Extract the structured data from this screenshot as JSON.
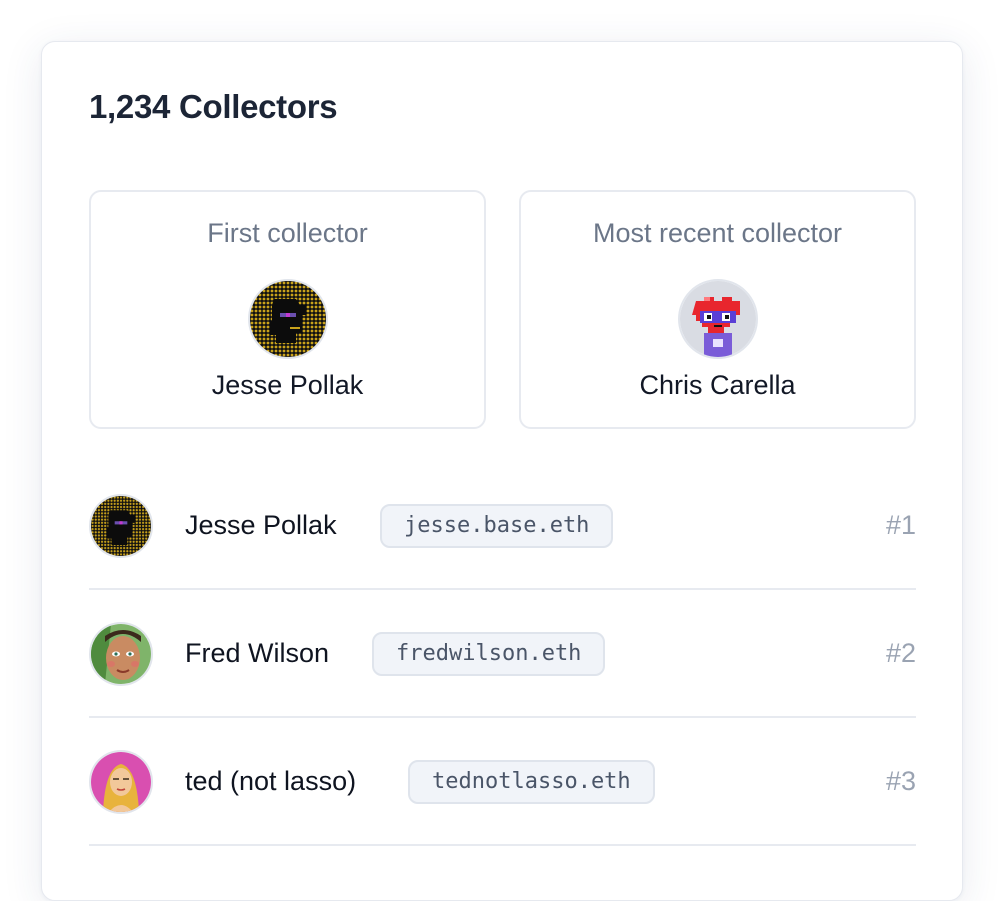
{
  "header": {
    "title": "1,234 Collectors"
  },
  "highlights": {
    "first": {
      "label": "First collector",
      "name": "Jesse Pollak",
      "avatar_icon": "pixel-punk-avatar-icon"
    },
    "recent": {
      "label": "Most recent collector",
      "name": "Chris Carella",
      "avatar_icon": "pixel-heart-avatar-icon"
    }
  },
  "collectors": [
    {
      "name": "Jesse Pollak",
      "handle": "jesse.base.eth",
      "rank": "#1",
      "avatar_icon": "pixel-punk-avatar-icon"
    },
    {
      "name": "Fred Wilson",
      "handle": "fredwilson.eth",
      "rank": "#2",
      "avatar_icon": "painted-portrait-avatar-icon"
    },
    {
      "name": "ted (not lasso)",
      "handle": "tednotlasso.eth",
      "rank": "#3",
      "avatar_icon": "pink-portrait-avatar-icon"
    }
  ],
  "colors": {
    "title": "#1c2536",
    "muted": "#6b7688",
    "rank": "#9aa3b2",
    "handle_bg": "#f1f4f9",
    "border": "#e7eaf0"
  }
}
